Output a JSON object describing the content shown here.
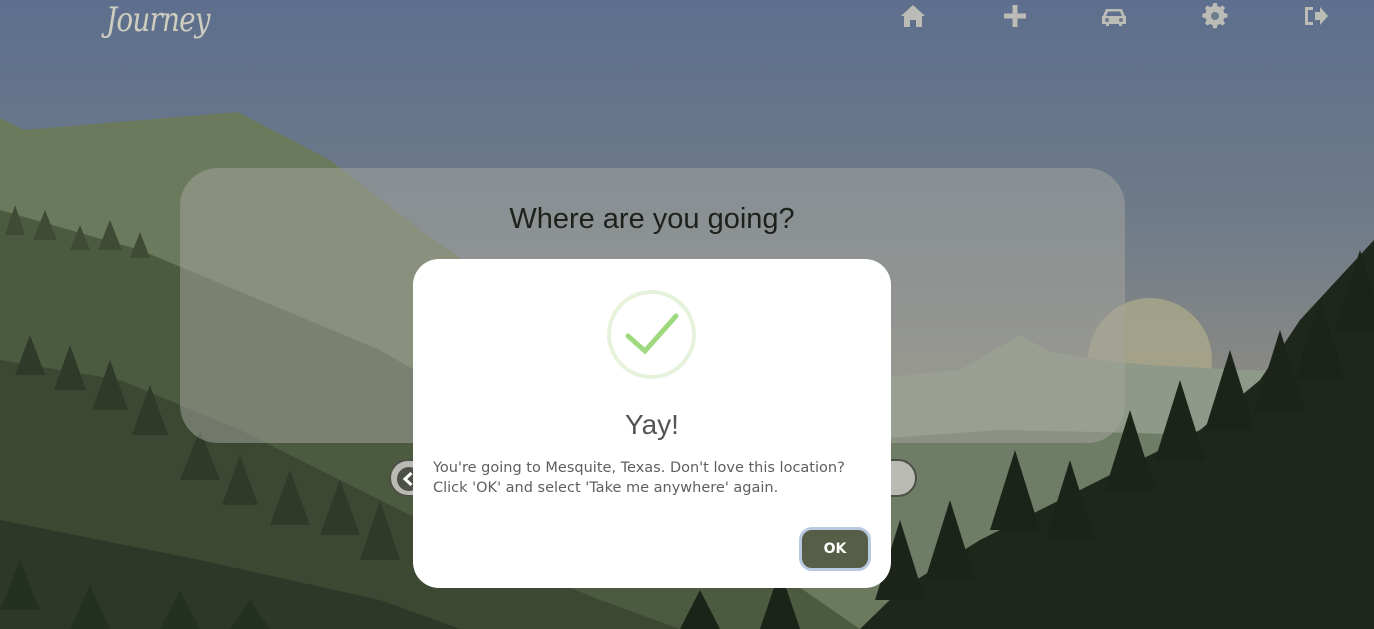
{
  "app": {
    "logo": "Journey"
  },
  "nav": {
    "items": [
      {
        "icon": "home-icon"
      },
      {
        "icon": "plus-icon"
      },
      {
        "icon": "car-icon"
      },
      {
        "icon": "gear-icon"
      },
      {
        "icon": "sign-out-icon"
      }
    ]
  },
  "main": {
    "prompt": "Where are you going?"
  },
  "modal": {
    "icon": "checkmark-icon",
    "title": "Yay!",
    "message_line1": "You're going to Mesquite, Texas. Don't love this location?",
    "message_line2": "Click 'OK' and select 'Take me anywhere' again.",
    "ok_label": "OK"
  },
  "colors": {
    "accent_button": "#565e47",
    "check_green": "#9fd97f",
    "sky_top": "#5f7190",
    "forest_dark": "#1f261b"
  }
}
